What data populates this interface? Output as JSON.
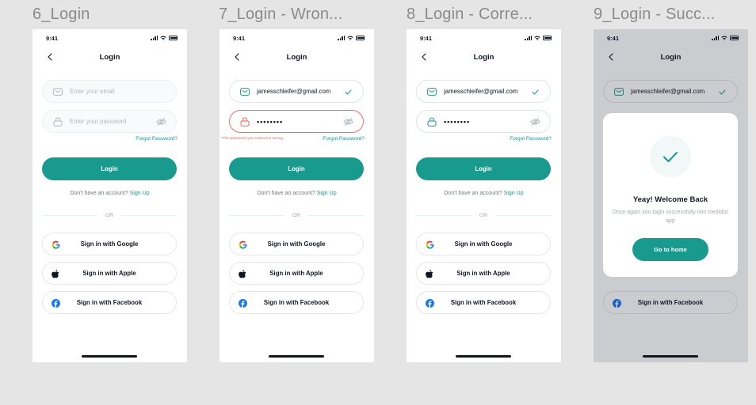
{
  "frames": [
    {
      "label": "6_Login",
      "status_time": "9:41",
      "title": "Login",
      "email": {
        "value": "",
        "placeholder": "Enter your email",
        "valid": false
      },
      "password": {
        "value": "",
        "placeholder": "Enter your password"
      },
      "forgot": "Forgot Password?",
      "error": "",
      "login_button": "Login",
      "signup_prompt": "Don't have an account?",
      "signup_link": "Sign Up",
      "or": "OR",
      "google": "Sign in with Google",
      "apple": "Sign in with Apple",
      "facebook": "Sign in with Facebook"
    },
    {
      "label": "7_Login - Wron...",
      "status_time": "9:41",
      "title": "Login",
      "email": {
        "value": "jamesschleifer@gmail.com",
        "placeholder": "",
        "valid": true
      },
      "password": {
        "value": "••••••••",
        "placeholder": ""
      },
      "forgot": "Forgot Password?",
      "error": "*The password you entered is wrong",
      "login_button": "Login",
      "signup_prompt": "Don't have an account?",
      "signup_link": "Sign Up",
      "or": "OR",
      "google": "Sign in with Google",
      "apple": "Sign in with Apple",
      "facebook": "Sign in with Facebook"
    },
    {
      "label": "8_Login - Corre...",
      "status_time": "9:41",
      "title": "Login",
      "email": {
        "value": "jamesschleifer@gmail.com",
        "placeholder": "",
        "valid": true
      },
      "password": {
        "value": "••••••••",
        "placeholder": ""
      },
      "forgot": "Forgot Password?",
      "error": "",
      "login_button": "Login",
      "signup_prompt": "Don't have an account?",
      "signup_link": "Sign Up",
      "or": "OR",
      "google": "Sign in with Google",
      "apple": "Sign in with Apple",
      "facebook": "Sign in with Facebook"
    },
    {
      "label": "9_Login - Succ...",
      "status_time": "9:41",
      "title": "Login",
      "email": {
        "value": "jamesschleifer@gmail.com",
        "placeholder": "",
        "valid": true
      },
      "facebook": "Sign in with Facebook",
      "modal": {
        "title": "Yeay! Welcome Back",
        "text": "Once again you login successfully into medidoc app",
        "button": "Go to home"
      }
    }
  ],
  "colors": {
    "accent": "#199a8e",
    "error": "#ff5c5c",
    "text": "#101623",
    "muted": "#a1a8b0",
    "background": "#e5e5e5"
  },
  "icons": [
    "back-chevron-icon",
    "mail-icon",
    "lock-icon",
    "eye-off-icon",
    "check-icon",
    "google-icon",
    "apple-icon",
    "facebook-icon",
    "signal-icon",
    "wifi-icon",
    "battery-icon"
  ]
}
